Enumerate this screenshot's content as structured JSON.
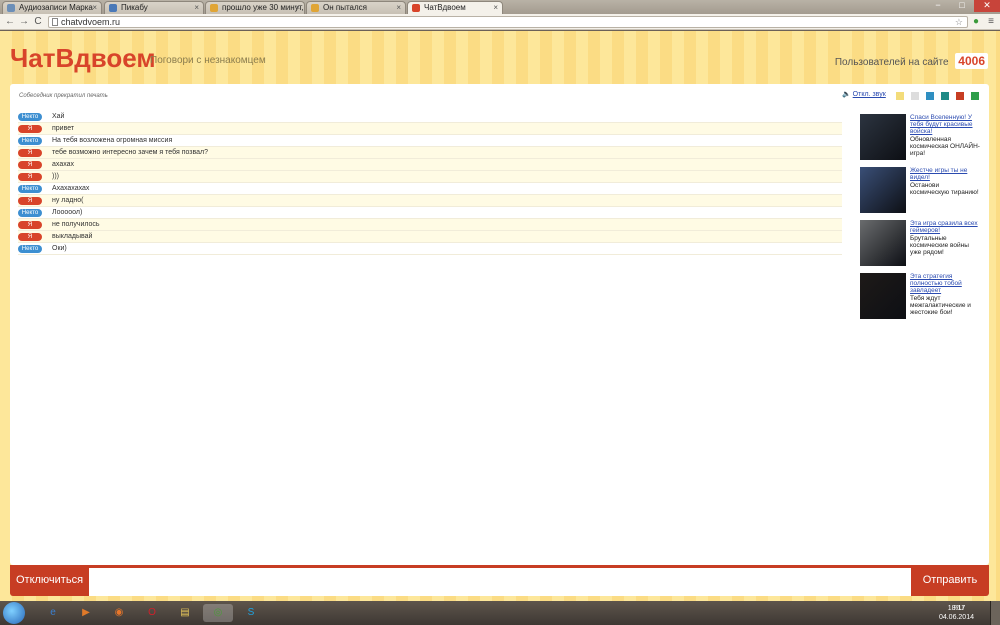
{
  "browser": {
    "tabs": [
      {
        "label": "Аудиозаписи Марка",
        "favicon": "#6c8fb8",
        "active": false
      },
      {
        "label": "Пикабу",
        "favicon": "#4a79b8",
        "active": false
      },
      {
        "label": "прошло уже 30 минут,",
        "favicon": "#e0a536",
        "active": false
      },
      {
        "label": "Он пытался",
        "favicon": "#e0a536",
        "active": false
      },
      {
        "label": "ЧатВдвоем",
        "favicon": "#d8442a",
        "active": true
      }
    ],
    "close_glyph": "×",
    "url": "chatvdvoem.ru",
    "window_controls": {
      "minimize": "−",
      "maximize": "□",
      "close": "✕"
    },
    "nav": {
      "back": "←",
      "forward": "→",
      "reload": "C"
    }
  },
  "header": {
    "logo": "ЧатВдвоем",
    "tagline": "Поговори с незнакомцем",
    "users_label": "Пользователей на сайте",
    "users_count": "4006"
  },
  "status": {
    "typing": "Собеседник прекратил печать",
    "sound_icon": "speaker-icon",
    "sound_toggle": "Откл. звук"
  },
  "theme_swatches": [
    "#f3dc7a",
    "#dddddd",
    "#2f8fc1",
    "#1f8a86",
    "#c73d23",
    "#2e9e4a"
  ],
  "messages": [
    {
      "sender": "Некто",
      "role": "stranger",
      "text": "Хай"
    },
    {
      "sender": "Я",
      "role": "self",
      "text": "привет"
    },
    {
      "sender": "Некто",
      "role": "stranger",
      "text": "На тебя возложена огромная миссия"
    },
    {
      "sender": "Я",
      "role": "self",
      "text": "тебе возможно интересно зачем я тебя позвал?"
    },
    {
      "sender": "Я",
      "role": "self",
      "text": "ахахах"
    },
    {
      "sender": "Я",
      "role": "self",
      "text": ")))"
    },
    {
      "sender": "Некто",
      "role": "stranger",
      "text": "Ахахахахах"
    },
    {
      "sender": "Я",
      "role": "self",
      "text": "ну ладно("
    },
    {
      "sender": "Некто",
      "role": "stranger",
      "text": "Лооооол)"
    },
    {
      "sender": "Я",
      "role": "self",
      "text": "не получилось"
    },
    {
      "sender": "Я",
      "role": "self",
      "text": "выкладывай"
    },
    {
      "sender": "Некто",
      "role": "stranger",
      "text": "Оки)"
    }
  ],
  "ads": [
    {
      "title": "Спаси Вселенную! У тебя будут красивые войска!",
      "desc": "Обновленная космическая ОНЛАЙН-игра!",
      "img": "#2c3440"
    },
    {
      "title": "Жестче игры ты не видел!",
      "desc": "Останови космическую тиранию!",
      "img": "#3a4f77"
    },
    {
      "title": "Эта игра сразила всех геймеров!",
      "desc": "Брутальные космические войны уже рядом!",
      "img": "#6a6c6e"
    },
    {
      "title": "Эта стратегия полностью тобой завладеет",
      "desc": "Тебя ждут межгалактические и жестокие бои!",
      "img": "#1e1a18"
    }
  ],
  "controls": {
    "disconnect": "Отключиться",
    "send": "Отправить",
    "input_value": ""
  },
  "taskbar": {
    "apps": [
      {
        "name": "ie-icon",
        "glyph": "e",
        "color": "#3a7fd0"
      },
      {
        "name": "media-player-icon",
        "glyph": "▶",
        "color": "#e07a2a"
      },
      {
        "name": "firefox-icon",
        "glyph": "◉",
        "color": "#e8762a"
      },
      {
        "name": "opera-icon",
        "glyph": "O",
        "color": "#d0202a"
      },
      {
        "name": "explorer-icon",
        "glyph": "▤",
        "color": "#e8c85a"
      },
      {
        "name": "chrome-icon",
        "glyph": "◎",
        "color": "#4c9a3a"
      },
      {
        "name": "skype-icon",
        "glyph": "S",
        "color": "#1fa3e0"
      }
    ],
    "lang": "RU",
    "time": "18:17",
    "date": "04.06.2014"
  }
}
